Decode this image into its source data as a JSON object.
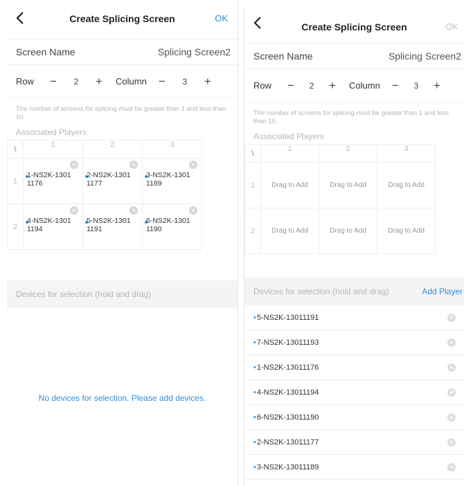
{
  "left": {
    "header": {
      "title": "Create Splicing Screen",
      "ok_label": "OK"
    },
    "screen_name": {
      "label": "Screen Name",
      "value": "Splicing Screen2"
    },
    "row": {
      "label": "Row",
      "value": "2"
    },
    "column": {
      "label": "Column",
      "value": "3"
    },
    "stepper": {
      "minus": "−",
      "plus": "+"
    },
    "hint": "The number of screens for splicing must be greater than 1 and less than 10.",
    "associated_label": "Associated Players",
    "grid": {
      "corner": "\\",
      "col_headers": [
        "1",
        "2",
        "3"
      ],
      "rows": [
        {
          "num": "1",
          "cells": [
            [
              "1-NS2K-1301",
              "1176"
            ],
            [
              "2-NS2K-1301",
              "1177"
            ],
            [
              "3-NS2K-1301",
              "1189"
            ]
          ]
        },
        {
          "num": "2",
          "cells": [
            [
              "4-NS2K-1301",
              "1194"
            ],
            [
              "5-NS2K-1301",
              "1191"
            ],
            [
              "6-NS2K-1301",
              "1190"
            ]
          ]
        }
      ]
    },
    "devices_label": "Devices for selection (hold and drag)",
    "empty_text": "No devices for selection. Please add devices."
  },
  "right": {
    "header": {
      "title": "Create Splicing Screen",
      "ok_label": "OK"
    },
    "screen_name": {
      "label": "Screen Name",
      "value": "Splicing Screen2"
    },
    "row": {
      "label": "Row",
      "value": "2"
    },
    "column": {
      "label": "Column",
      "value": "3"
    },
    "hint": "The number of screens for splicing must be greater than 1 and less than 10.",
    "associated_label": "Associated Players",
    "grid": {
      "corner": "\\",
      "col_headers": [
        "1",
        "2",
        "3"
      ],
      "row_nums": [
        "1",
        "2"
      ],
      "drag_label": "Drag to Add"
    },
    "devices_label": "Devices for selection (hold and drag)",
    "add_player": "Add Player",
    "devices": [
      "5-NS2K-13011191",
      "7-NS2K-13011193",
      "1-NS2K-13011176",
      "4-NS2K-13011194",
      "6-NS2K-13011190",
      "2-NS2K-13011177",
      "3-NS2K-13011189"
    ]
  },
  "colors": {
    "accent": "#2f8fd8",
    "section_bg": "#f4f4f4",
    "muted": "#b5b5b5"
  }
}
